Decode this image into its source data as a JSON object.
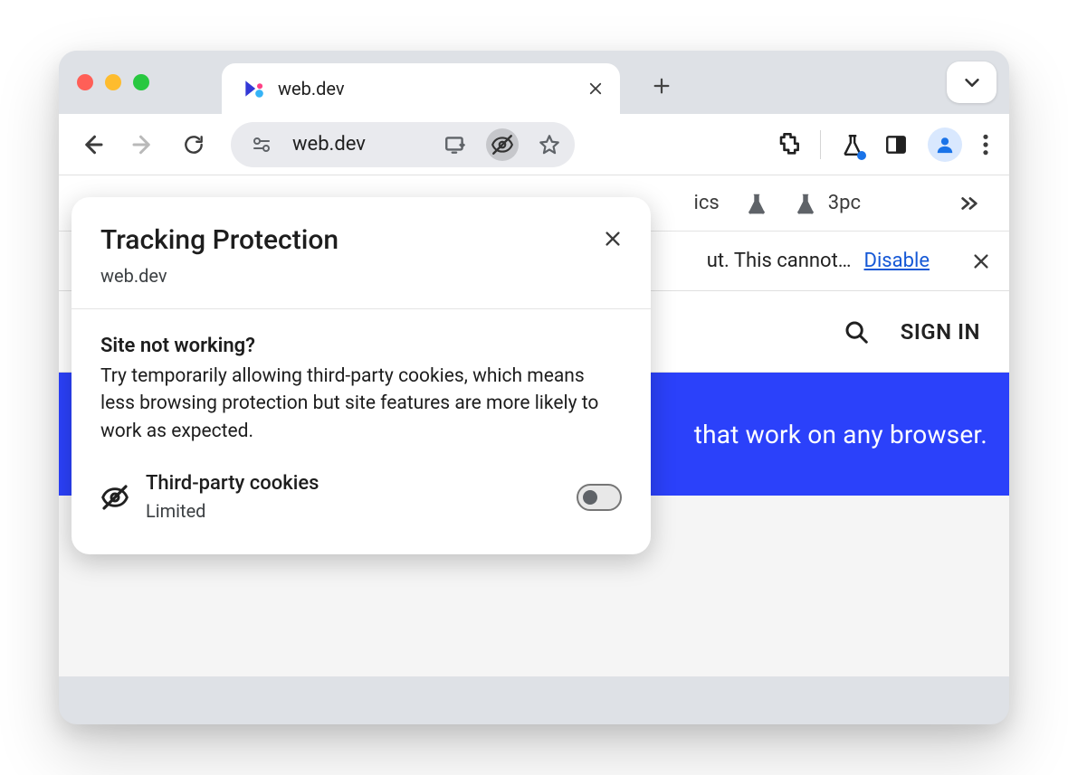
{
  "tab": {
    "title": "web.dev"
  },
  "omnibox": {
    "address": "web.dev"
  },
  "ext_bar": {
    "partial_label": "ics",
    "third_item_label": "3pc"
  },
  "info_bar": {
    "partial_text": "ut. This cannot…",
    "disable_label": "Disable"
  },
  "site_header": {
    "sign_in_label": "SIGN IN"
  },
  "banner": {
    "partial_text": "that work on any browser."
  },
  "popup": {
    "title": "Tracking Protection",
    "site": "web.dev",
    "snw_title": "Site not working?",
    "snw_body": "Try temporarily allowing third-party cookies, which means less browsing protection but site features are more likely to work as expected.",
    "tpc_label": "Third-party cookies",
    "tpc_status": "Limited"
  }
}
